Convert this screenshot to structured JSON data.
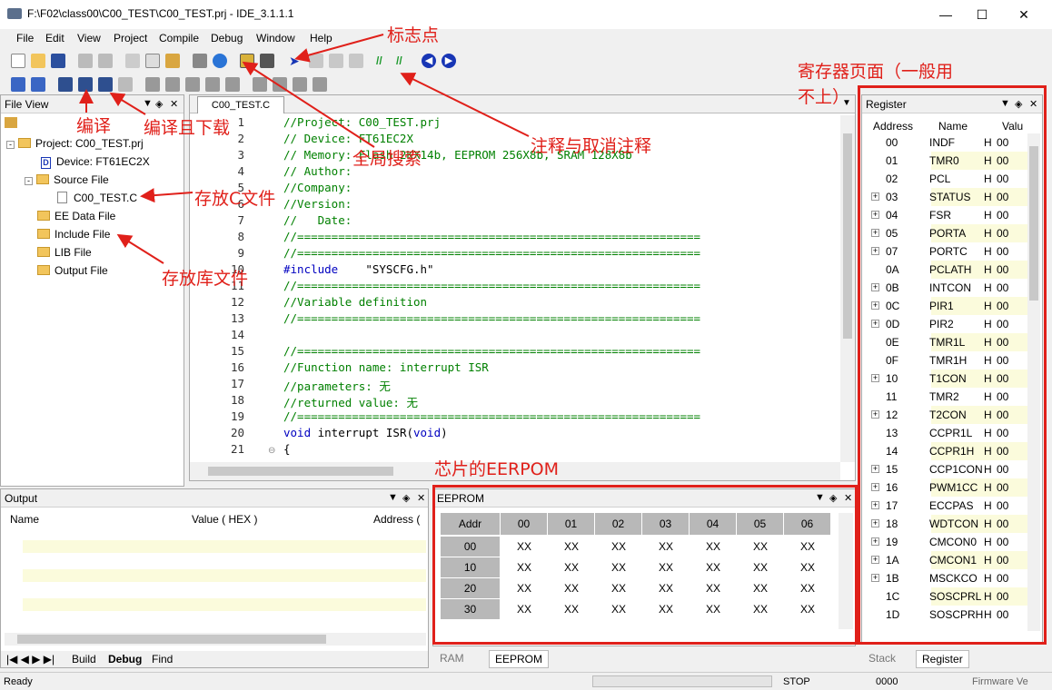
{
  "window": {
    "title": "F:\\F02\\class00\\C00_TEST\\C00_TEST.prj - IDE_3.1.1.1"
  },
  "menu": [
    "File",
    "Edit",
    "View",
    "Project",
    "Compile",
    "Debug",
    "Window",
    "Help"
  ],
  "file_view": {
    "title": "File View",
    "project": "Project:  C00_TEST.prj",
    "device": "Device:  FT61EC2X",
    "source_folder": "Source File",
    "source_file": "C00_TEST.C",
    "ee_folder": "EE Data File",
    "include_folder": "Include File",
    "lib_folder": "LIB File",
    "output_folder": "Output File"
  },
  "editor": {
    "tab": "C00_TEST.C",
    "lines": [
      {
        "n": "1",
        "t": "//Project: C00_TEST.prj"
      },
      {
        "n": "2",
        "t": "// Device: FT61EC2X"
      },
      {
        "n": "3",
        "t": "// Memory: Flash 2KX14b, EEPROM 256X8b, SRAM 128X8b"
      },
      {
        "n": "4",
        "t": "// Author:"
      },
      {
        "n": "5",
        "t": "//Company:"
      },
      {
        "n": "6",
        "t": "//Version:"
      },
      {
        "n": "7",
        "t": "//   Date:"
      },
      {
        "n": "8",
        "t": "//==========================================================="
      },
      {
        "n": "9",
        "t": "//==========================================================="
      },
      {
        "n": "10",
        "t": "#include    \"SYSCFG.h\""
      },
      {
        "n": "11",
        "t": "//==========================================================="
      },
      {
        "n": "12",
        "t": "//Variable definition"
      },
      {
        "n": "13",
        "t": "//==========================================================="
      },
      {
        "n": "14",
        "t": ""
      },
      {
        "n": "15",
        "t": "//==========================================================="
      },
      {
        "n": "16",
        "t": "//Function name: interrupt ISR"
      },
      {
        "n": "17",
        "t": "//parameters: 无"
      },
      {
        "n": "18",
        "t": "//returned value: 无"
      },
      {
        "n": "19",
        "t": "//==========================================================="
      },
      {
        "n": "20",
        "t": "void interrupt ISR(void)"
      },
      {
        "n": "21",
        "t": "{"
      }
    ]
  },
  "output": {
    "title": "Output",
    "col_name": "Name",
    "col_value": "Value ( HEX )",
    "col_addr": "Address (",
    "tabs": [
      "Build",
      "Debug",
      "Find"
    ]
  },
  "eeprom": {
    "title": "EEPROM",
    "headers": [
      "Addr",
      "00",
      "01",
      "02",
      "03",
      "04",
      "05",
      "06"
    ],
    "rows": [
      {
        "addr": "00",
        "v": [
          "XX",
          "XX",
          "XX",
          "XX",
          "XX",
          "XX",
          "XX"
        ]
      },
      {
        "addr": "10",
        "v": [
          "XX",
          "XX",
          "XX",
          "XX",
          "XX",
          "XX",
          "XX"
        ]
      },
      {
        "addr": "20",
        "v": [
          "XX",
          "XX",
          "XX",
          "XX",
          "XX",
          "XX",
          "XX"
        ]
      },
      {
        "addr": "30",
        "v": [
          "XX",
          "XX",
          "XX",
          "XX",
          "XX",
          "XX",
          "XX"
        ]
      }
    ],
    "tabs": [
      "RAM",
      "EEPROM"
    ]
  },
  "register": {
    "title": "Register",
    "cols": [
      "Address",
      "Name",
      "Valu"
    ],
    "rows": [
      {
        "a": "00",
        "n": "INDF",
        "h": "H",
        "v": "00",
        "x": false
      },
      {
        "a": "01",
        "n": "TMR0",
        "h": "H",
        "v": "00",
        "x": false
      },
      {
        "a": "02",
        "n": "PCL",
        "h": "H",
        "v": "00",
        "x": false
      },
      {
        "a": "03",
        "n": "STATUS",
        "h": "H",
        "v": "00",
        "x": true
      },
      {
        "a": "04",
        "n": "FSR",
        "h": "H",
        "v": "00",
        "x": true
      },
      {
        "a": "05",
        "n": "PORTA",
        "h": "H",
        "v": "00",
        "x": true
      },
      {
        "a": "07",
        "n": "PORTC",
        "h": "H",
        "v": "00",
        "x": true
      },
      {
        "a": "0A",
        "n": "PCLATH",
        "h": "H",
        "v": "00",
        "x": false
      },
      {
        "a": "0B",
        "n": "INTCON",
        "h": "H",
        "v": "00",
        "x": true
      },
      {
        "a": "0C",
        "n": "PIR1",
        "h": "H",
        "v": "00",
        "x": true
      },
      {
        "a": "0D",
        "n": "PIR2",
        "h": "H",
        "v": "00",
        "x": true
      },
      {
        "a": "0E",
        "n": "TMR1L",
        "h": "H",
        "v": "00",
        "x": false
      },
      {
        "a": "0F",
        "n": "TMR1H",
        "h": "H",
        "v": "00",
        "x": false
      },
      {
        "a": "10",
        "n": "T1CON",
        "h": "H",
        "v": "00",
        "x": true
      },
      {
        "a": "11",
        "n": "TMR2",
        "h": "H",
        "v": "00",
        "x": false
      },
      {
        "a": "12",
        "n": "T2CON",
        "h": "H",
        "v": "00",
        "x": true
      },
      {
        "a": "13",
        "n": "CCPR1L",
        "h": "H",
        "v": "00",
        "x": false
      },
      {
        "a": "14",
        "n": "CCPR1H",
        "h": "H",
        "v": "00",
        "x": false
      },
      {
        "a": "15",
        "n": "CCP1CON",
        "h": "H",
        "v": "00",
        "x": true
      },
      {
        "a": "16",
        "n": "PWM1CC",
        "h": "H",
        "v": "00",
        "x": true
      },
      {
        "a": "17",
        "n": "ECCPAS",
        "h": "H",
        "v": "00",
        "x": true
      },
      {
        "a": "18",
        "n": "WDTCON",
        "h": "H",
        "v": "00",
        "x": true
      },
      {
        "a": "19",
        "n": "CMCON0",
        "h": "H",
        "v": "00",
        "x": true
      },
      {
        "a": "1A",
        "n": "CMCON1",
        "h": "H",
        "v": "00",
        "x": true
      },
      {
        "a": "1B",
        "n": "MSCKCO",
        "h": "H",
        "v": "00",
        "x": true
      },
      {
        "a": "1C",
        "n": "SOSCPRL",
        "h": "H",
        "v": "00",
        "x": false
      },
      {
        "a": "1D",
        "n": "SOSCPRH",
        "h": "H",
        "v": "00",
        "x": false
      }
    ],
    "tabs": [
      "Stack",
      "Register"
    ]
  },
  "status": {
    "ready": "Ready",
    "stop": "STOP",
    "addr": "0000",
    "firmware": "Firmware Ve"
  },
  "annotations": {
    "marker": "标志点",
    "register_page": "寄存器页面（一般用",
    "register_page2": "不上）",
    "compile": "编译",
    "compile_download": "编译且下载",
    "global_search": "全局搜索",
    "comment_toggle": "注释与取消注释",
    "c_file": "存放C文件",
    "lib_file": "存放库文件",
    "eeprom_chip": "芯片的EERPOM"
  }
}
